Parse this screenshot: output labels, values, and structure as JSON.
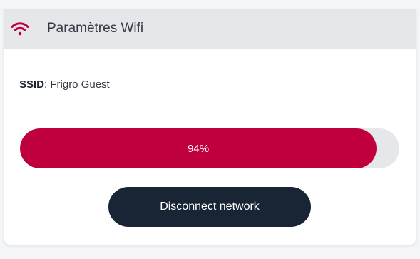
{
  "header": {
    "title": "Paramètres Wifi",
    "icon": "wifi-icon"
  },
  "network": {
    "ssid_label": "SSID",
    "ssid_value": "Frigro Guest"
  },
  "signal": {
    "percent": 94,
    "label": "94%"
  },
  "actions": {
    "disconnect_label": "Disconnect network"
  },
  "colors": {
    "accent": "#c0003c",
    "button_dark": "#192535",
    "header_bg": "#e5e6e9"
  }
}
